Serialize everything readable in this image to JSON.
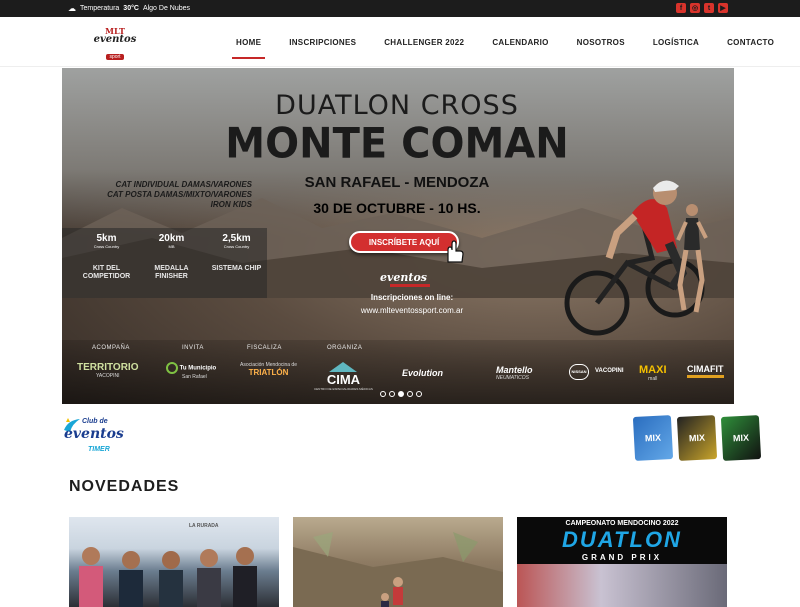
{
  "topbar": {
    "weather_label": "Temperatura",
    "temp": "30°C",
    "condition": "Algo De Nubes",
    "social_icons": [
      "facebook-icon",
      "instagram-icon",
      "twitter-icon",
      "youtube-icon"
    ]
  },
  "brand": {
    "line1": "MLT",
    "line2": "eventos",
    "line3": "sport"
  },
  "nav": [
    {
      "label": "HOME",
      "active": true
    },
    {
      "label": "INSCRIPCIONES"
    },
    {
      "label": "CHALLENGER 2022"
    },
    {
      "label": "CALENDARIO"
    },
    {
      "label": "NOSOTROS"
    },
    {
      "label": "LOGÍSTICA"
    },
    {
      "label": "CONTACTO"
    }
  ],
  "hero": {
    "title1": "DUATLON CROSS",
    "title2": "MONTE COMAN",
    "title3": "SAN RAFAEL - MENDOZA",
    "title4": "30 DE OCTUBRE - 10 HS.",
    "categories": [
      "CAT INDIVIDUAL DAMAS/VARONES",
      "CAT POSTA DAMAS/MIXTO/VARONES",
      "IRON KIDS"
    ],
    "stats": [
      {
        "value": "5km",
        "sub": "Cross Country"
      },
      {
        "value": "20km",
        "sub": "MB"
      },
      {
        "value": "2,5km",
        "sub": "Cross Country"
      }
    ],
    "perks": [
      "KIT DEL COMPETIDOR",
      "MEDALLA FINISHER",
      "SISTEMA CHIP"
    ],
    "cta": "INSCRÍBETE AQUÍ",
    "eventos_logo": "eventos",
    "inscripciones": "Inscripciones on line:",
    "url": "www.mlteventossport.com.ar",
    "sponsor_labels": {
      "acompana": "ACOMPAÑA",
      "invita": "INVITA",
      "fiscaliza": "FISCALIZA",
      "organiza": "ORGANIZA"
    },
    "sponsors": {
      "territorio": "TERRITORIO",
      "territorio_sub": "YACOPINI",
      "municipio": "Tu Municipio",
      "municipio_sub": "San Rafael",
      "triatlon": "TRIATLÓN",
      "triatlon_sub": "Asociación Mendocina de",
      "cima": "CIMA",
      "cima_sub": "CENTRO DE ESPECIALIDADES MÉDICAS",
      "evolution": "Evolution",
      "mantello": "Mantello",
      "mantello_sub": "NEUMATICOS",
      "nissan": "NISSAN",
      "vacopini": "VACOPINI",
      "maxi": "MAXI",
      "maxi_sub": "mall",
      "cimafit": "CIMAFIT"
    },
    "slides": 5,
    "active_slide": 3
  },
  "club": {
    "l1": "Club de",
    "l2": "eventos",
    "l3": "TIMER"
  },
  "bags": [
    "MIX",
    "MIX",
    "MIX"
  ],
  "section_title": "NOVEDADES",
  "cards": [
    {
      "banner": "LA RURADA"
    },
    {},
    {
      "header": "CAMPEONATO MENDOCINO 2022",
      "big": "DUATLON",
      "sub": "GRAND PRIX"
    }
  ]
}
